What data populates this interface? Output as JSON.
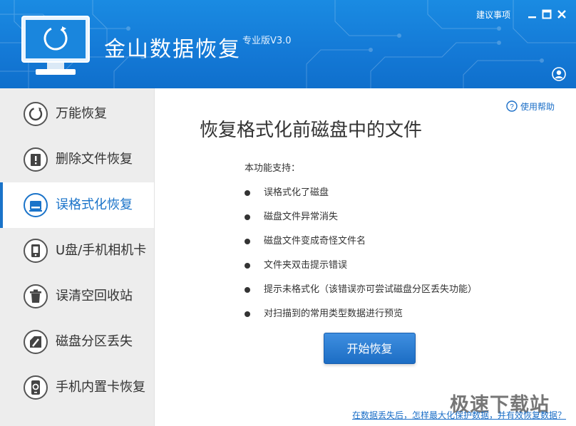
{
  "header": {
    "app_title": "金山数据恢复",
    "edition": "专业版V3.0",
    "feedback_label": "建议事项",
    "colors": {
      "accent": "#1479d6",
      "sidebar_bg": "#ededed",
      "active_text": "#1a73c9"
    }
  },
  "window_controls": {
    "icons": [
      "minimize-icon",
      "maximize-icon",
      "close-icon"
    ]
  },
  "sidebar": {
    "items": [
      {
        "label": "万能恢复",
        "icon": "restore-icon",
        "active": false
      },
      {
        "label": "删除文件恢复",
        "icon": "delete-file-icon",
        "active": false
      },
      {
        "label": "误格式化恢复",
        "icon": "disk-format-icon",
        "active": true
      },
      {
        "label": "U盘/手机相机卡",
        "icon": "usb-device-icon",
        "active": false
      },
      {
        "label": "误清空回收站",
        "icon": "recycle-bin-icon",
        "active": false
      },
      {
        "label": "磁盘分区丢失",
        "icon": "partition-icon",
        "active": false
      },
      {
        "label": "手机内置卡恢复",
        "icon": "phone-card-icon",
        "active": false
      }
    ]
  },
  "main": {
    "help_label": "使用帮助",
    "title": "恢复格式化前磁盘中的文件",
    "features_title": "本功能支持：",
    "features": [
      "误格式化了磁盘",
      "磁盘文件异常消失",
      "磁盘文件变成奇怪文件名",
      "文件夹双击提示错误",
      "提示未格式化（该错误亦可尝试磁盘分区丢失功能）",
      "对扫描到的常用类型数据进行预览"
    ],
    "start_button": "开始恢复",
    "bottom_link": "在数据丢失后，怎样最大化保护数据，并有效恢复数据？"
  },
  "watermark": "极速下载站"
}
